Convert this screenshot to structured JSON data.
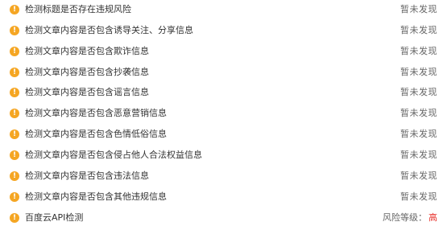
{
  "checks": [
    {
      "label": "检测标题是否存在违规风险",
      "status": "暂未发现",
      "icon": "warning-icon"
    },
    {
      "label": "检测文章内容是否包含诱导关注、分享信息",
      "status": "暂未发现",
      "icon": "warning-icon"
    },
    {
      "label": "检测文章内容是否包含欺诈信息",
      "status": "暂未发现",
      "icon": "warning-icon"
    },
    {
      "label": "检测文章内容是否包含抄袭信息",
      "status": "暂未发现",
      "icon": "warning-icon"
    },
    {
      "label": "检测文章内容是否包含谣言信息",
      "status": "暂未发现",
      "icon": "warning-icon"
    },
    {
      "label": "检测文章内容是否包含恶意营销信息",
      "status": "暂未发现",
      "icon": "warning-icon"
    },
    {
      "label": "检测文章内容是否包含色情低俗信息",
      "status": "暂未发现",
      "icon": "warning-icon"
    },
    {
      "label": "检测文章内容是否包含侵占他人合法权益信息",
      "status": "暂未发现",
      "icon": "warning-icon"
    },
    {
      "label": "检测文章内容是否包含违法信息",
      "status": "暂未发现",
      "icon": "warning-icon"
    },
    {
      "label": "检测文章内容是否包含其他违规信息",
      "status": "暂未发现",
      "icon": "warning-icon"
    }
  ],
  "baidu_check": {
    "label": "百度云API检测",
    "risk_label": "风险等级：",
    "risk_value": "高",
    "icon": "warning-icon"
  },
  "icon_glyph": "!",
  "colors": {
    "warning_icon": "#f5a623",
    "risk_high": "#e8302a",
    "status_text": "#666666",
    "label_text": "#333333"
  }
}
